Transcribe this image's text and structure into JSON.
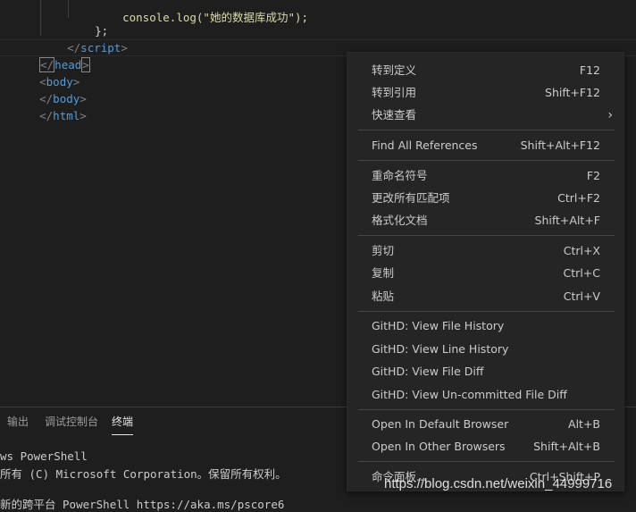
{
  "editor": {
    "lines": [
      {
        "text": "console.log(\"她的数据库成功\");"
      },
      {
        "indent": "};"
      },
      {
        "open": "</",
        "tag": "script",
        "close": ">"
      },
      {
        "open": "</",
        "tag": "head",
        "close": ">"
      },
      {
        "open": "<",
        "tag": "body",
        "close": ">"
      },
      {
        "open": "</",
        "tag": "body",
        "close": ">"
      },
      {
        "open": "</",
        "tag": "html",
        "close": ">"
      }
    ]
  },
  "panel": {
    "tabs": [
      "输出",
      "调试控制台",
      "终端"
    ],
    "active_tab": "终端",
    "terminal_lines": [
      "ws PowerShell",
      "所有 (C) Microsoft Corporation。保留所有权利。",
      "",
      "新的跨平台 PowerShell https://aka.ms/pscore6"
    ]
  },
  "context_menu": {
    "items": [
      {
        "label": "转到定义",
        "shortcut": "F12"
      },
      {
        "label": "转到引用",
        "shortcut": "Shift+F12"
      },
      {
        "label": "快速查看",
        "shortcut": ""
      },
      {
        "label": "Find All References",
        "shortcut": "Shift+Alt+F12"
      },
      {
        "label": "重命名符号",
        "shortcut": "F2"
      },
      {
        "label": "更改所有匹配项",
        "shortcut": "Ctrl+F2"
      },
      {
        "label": "格式化文档",
        "shortcut": "Shift+Alt+F"
      },
      {
        "label": "剪切",
        "shortcut": "Ctrl+X"
      },
      {
        "label": "复制",
        "shortcut": "Ctrl+C"
      },
      {
        "label": "粘贴",
        "shortcut": "Ctrl+V"
      },
      {
        "label": "GitHD: View File History",
        "shortcut": ""
      },
      {
        "label": "GitHD: View Line History",
        "shortcut": ""
      },
      {
        "label": "GitHD: View File Diff",
        "shortcut": ""
      },
      {
        "label": "GitHD: View Un-committed File Diff",
        "shortcut": ""
      },
      {
        "label": "Open In Default Browser",
        "shortcut": "Alt+B"
      },
      {
        "label": "Open In Other Browsers",
        "shortcut": "Shift+Alt+B"
      },
      {
        "label": "命令面板...",
        "shortcut": "Ctrl+Shift+P"
      }
    ],
    "submenu_icon": "chevron-right-icon"
  },
  "watermark": "https://blog.csdn.net/weixin_44999716",
  "colors": {
    "tag": "#569cd6",
    "bracket": "#808080",
    "menu_bg": "#252526",
    "editor_bg": "#1e1e1e"
  }
}
